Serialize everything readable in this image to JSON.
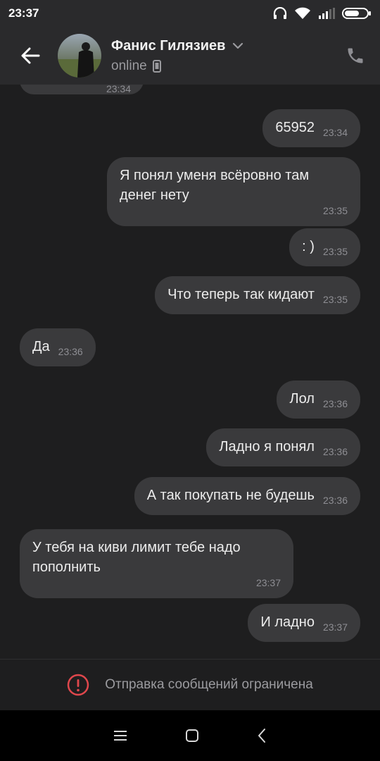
{
  "status_bar": {
    "time": "23:37",
    "icons": [
      "headphones-icon",
      "wifi-icon",
      "signal-icon",
      "battery-icon"
    ]
  },
  "header": {
    "contact_name": "Фанис Гилязиев",
    "status": "online",
    "icons": [
      "back-arrow-icon",
      "chevron-down-icon",
      "mobile-device-icon",
      "phone-icon"
    ]
  },
  "messages": [
    {
      "direction": "out",
      "text": "65952",
      "time": "23:34"
    },
    {
      "direction": "out",
      "text": "Я понял уменя всёровно там денег нету",
      "time": "23:35"
    },
    {
      "direction": "out",
      "text": ": )",
      "time": "23:35"
    },
    {
      "direction": "out",
      "text": "Что теперь так кидают",
      "time": "23:35"
    },
    {
      "direction": "in",
      "text": "Да",
      "time": "23:36"
    },
    {
      "direction": "out",
      "text": "Лол",
      "time": "23:36"
    },
    {
      "direction": "out",
      "text": "Ладно я понял",
      "time": "23:36"
    },
    {
      "direction": "out",
      "text": "А так покупать не будешь",
      "time": "23:36"
    },
    {
      "direction": "in",
      "text": "У тебя на киви лимит тебе надо пополнить",
      "time": "23:37"
    },
    {
      "direction": "out",
      "text": "И ладно",
      "time": "23:37"
    }
  ],
  "partial_message_time": "23:34",
  "restriction": {
    "text": "Отправка сообщений ограничена",
    "icon": "alert-icon",
    "color": "#e0474c"
  },
  "colors": {
    "background": "#1e1e1f",
    "bubble": "#3a3a3c",
    "header": "#2a2a2c"
  }
}
